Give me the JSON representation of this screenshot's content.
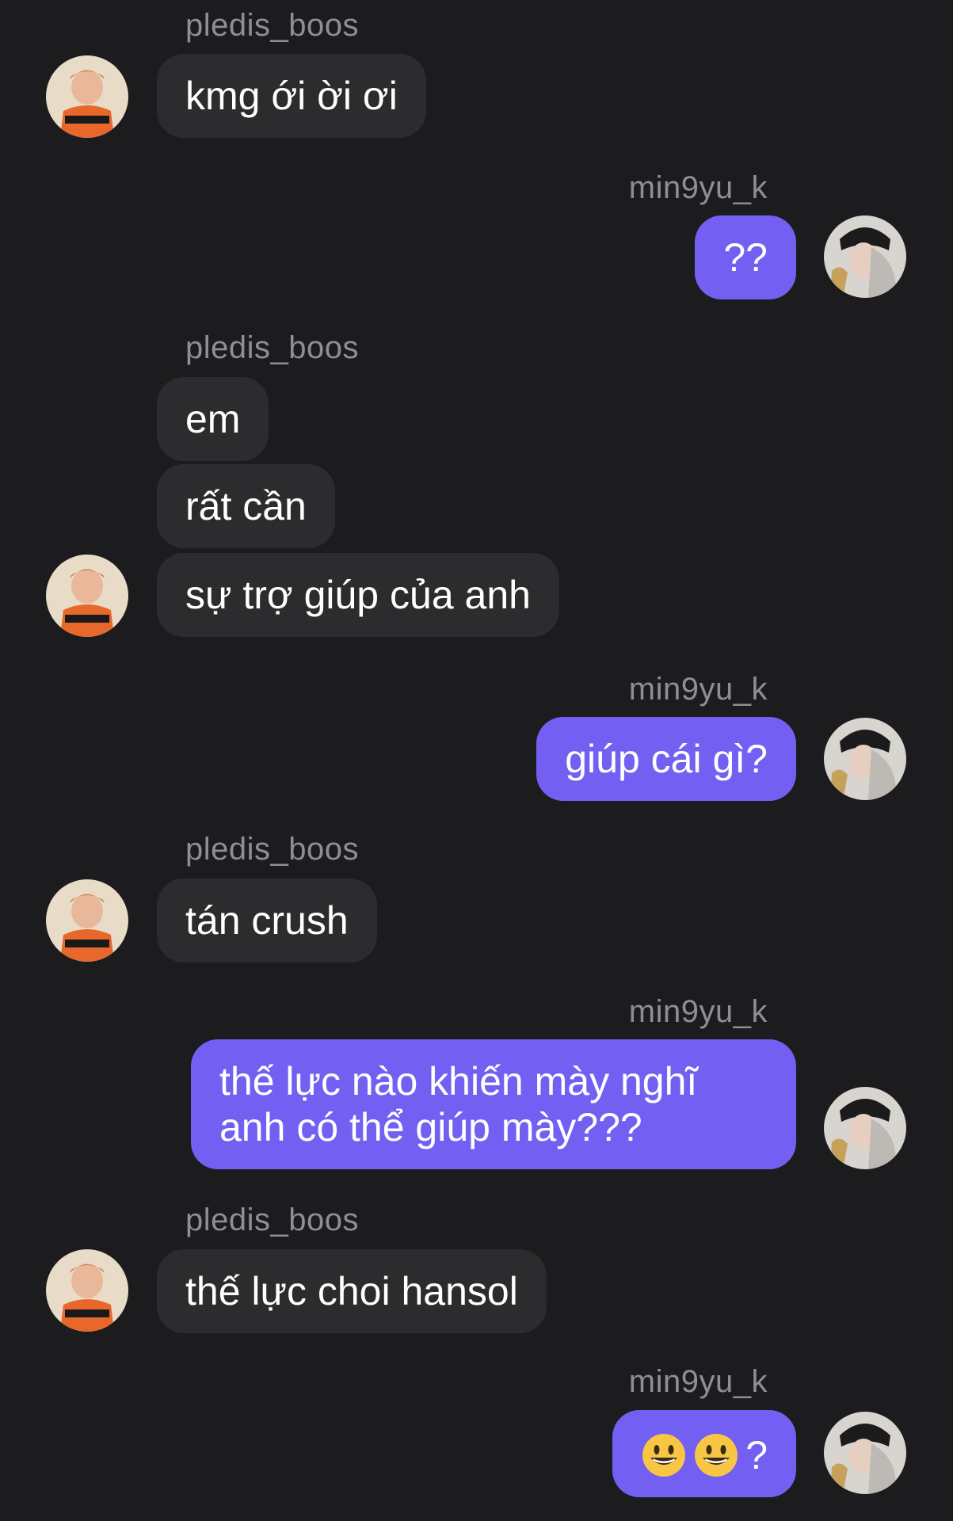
{
  "users": {
    "left": "pledis_boos",
    "right": "min9yu_k"
  },
  "messages": [
    {
      "text": "kmg ới ời ơi"
    },
    {
      "text": "??"
    },
    {
      "text": "em"
    },
    {
      "text": "rất cần"
    },
    {
      "text": "sự trợ giúp của anh"
    },
    {
      "text": "giúp cái gì?"
    },
    {
      "text": "tán crush"
    },
    {
      "text": "thế lực nào khiến mày nghĩ anh có thể giúp mày???"
    },
    {
      "text": "thế lực choi hansol"
    },
    {
      "text": "?"
    }
  ],
  "colors": {
    "background": "#1c1c1e",
    "incoming_bubble": "#2c2c2e",
    "outgoing_bubble": "#7360f2",
    "username": "#8e8e93"
  }
}
